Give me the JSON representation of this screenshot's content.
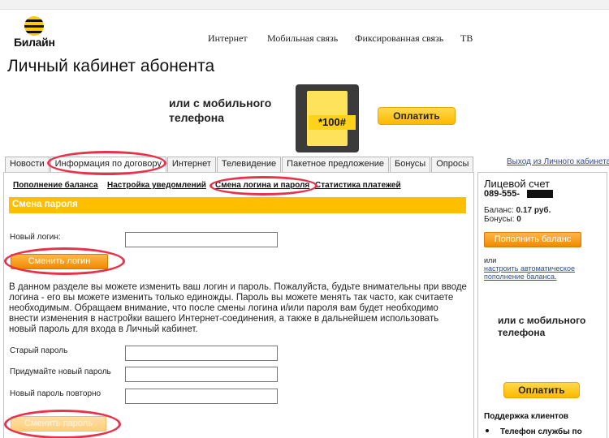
{
  "brand": {
    "name": "Билайн",
    "accent": "#ffcc00"
  },
  "main_nav": [
    "Интернет",
    "Мобильная связь",
    "Фиксированная связь",
    "ТВ"
  ],
  "page_title": "Личный кабинет абонента",
  "top_banner": {
    "text": "или с мобильного телефона",
    "code": "*100#",
    "pay_label": "Оплатить"
  },
  "tabs": [
    {
      "label": "Новости",
      "active": false
    },
    {
      "label": "Информация по договору",
      "active": true
    },
    {
      "label": "Интернет",
      "active": false
    },
    {
      "label": "Телевидение",
      "active": false
    },
    {
      "label": "Пакетное предложение",
      "active": false
    },
    {
      "label": "Бонусы",
      "active": false
    },
    {
      "label": "Опросы",
      "active": false
    }
  ],
  "logout_label": "Выход из Личного кабинета",
  "subnav": [
    "Пополнение баланса",
    "Настройка уведомлений",
    "Смена логина и пароля",
    "Статистика платежей"
  ],
  "section_title": "Смена пароля",
  "login_form": {
    "label": "Новый логин:",
    "value": "",
    "button": "Сменить логин"
  },
  "description": "В данном разделе вы можете изменить ваш логин и пароль. Пожалуйста, будьте внимательны при вводе логина - его вы можете изменить только единожды. Пароль вы можете менять так часто, как считаете необходимым. Обращаем внимание, что после смены логина и/или пароля вам будет необходимо внести изменения в настройки вашего Интернет-соединения, а также в дальнейшем использовать новый пароль для входа в Личный кабинет.",
  "password_form": {
    "old_label": "Старый пароль",
    "new_label": "Придумайте новый пароль",
    "repeat_label": "Новый пароль повторно",
    "button": "Сменить пароль"
  },
  "sidebar": {
    "account_title": "Лицевой счет",
    "account_number": "089-555-",
    "balance_label": "Баланс:",
    "balance_value": "0.17 руб.",
    "bonus_label": "Бонусы:",
    "bonus_value": "0",
    "topup_button": "Пополнить баланс",
    "or_text": "или",
    "autopay_link": "настроить автоматическое пополнение баланса.",
    "banner_text": "или с мобильного телефона",
    "pay_label": "Оплатить",
    "support_title": "Поддержка клиентов",
    "support_item": "Телефон службы по"
  },
  "annotation_color": "#e8324a"
}
